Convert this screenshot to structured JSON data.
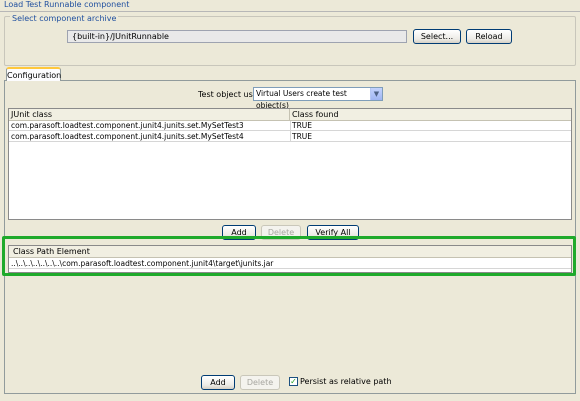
{
  "page": {
    "title": "Load Test Runnable component"
  },
  "archive": {
    "group_label": "Select component archive",
    "value": "{built-in}/JUnitRunnable",
    "select_label": "Select...",
    "reload_label": "Reload"
  },
  "tabs": [
    {
      "label": "Configuration",
      "active": true
    }
  ],
  "test_object": {
    "label": "Test object use",
    "selected": "Virtual Users create test object(s)"
  },
  "junit_table": {
    "columns": [
      "JUnit class",
      "Class found"
    ],
    "rows": [
      [
        "com.parasoft.loadtest.component.junit4.junits.set.MySetTest3",
        "TRUE"
      ],
      [
        "com.parasoft.loadtest.component.junit4.junits.set.MySetTest4",
        "TRUE"
      ]
    ],
    "add_label": "Add",
    "delete_label": "Delete",
    "verify_label": "Verify All"
  },
  "classpath_table": {
    "column": "Class Path Element",
    "rows": [
      "..\\..\\..\\..\\..\\..\\..\\com.parasoft.loadtest.component.junit4\\target\\junits.jar"
    ],
    "add_label": "Add",
    "delete_label": "Delete",
    "persist_label": "Persist as relative path",
    "persist_checked": true
  },
  "colors": {
    "highlight": "#1faa2b",
    "title": "#1f4f9f"
  }
}
